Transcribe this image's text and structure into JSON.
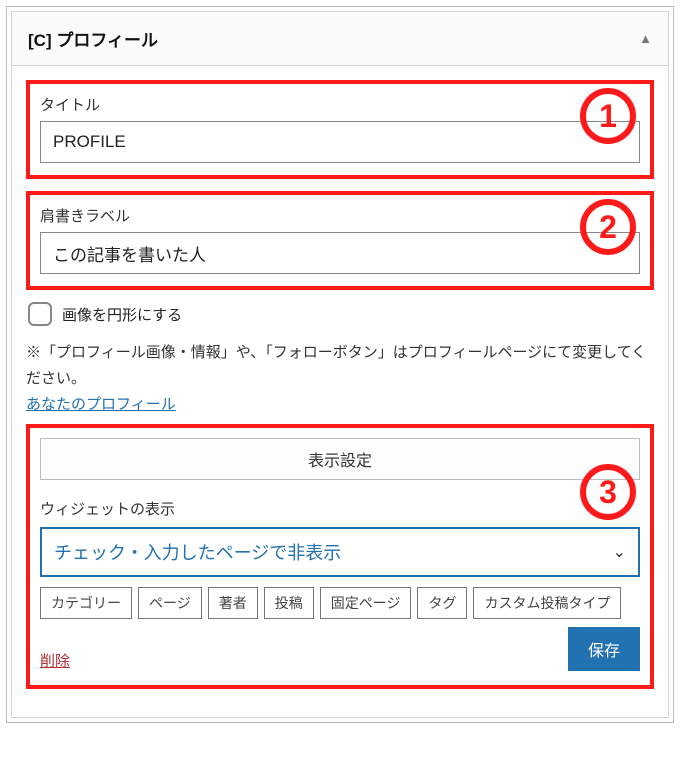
{
  "widget": {
    "title": "[C] プロフィール"
  },
  "section1": {
    "label": "タイトル",
    "value": "PROFILE",
    "badge": "1"
  },
  "section2": {
    "label": "肩書きラベル",
    "value": "この記事を書いた人",
    "badge": "2"
  },
  "checkbox": {
    "label": "画像を円形にする"
  },
  "note": {
    "text": "※「プロフィール画像・情報」や、「フォローボタン」はプロフィールページにて変更してください。",
    "link": "あなたのプロフィール"
  },
  "section3": {
    "details_button": "表示設定",
    "badge": "3",
    "sub_label": "ウィジェットの表示",
    "select_value": "チェック・入力したページで非表示",
    "tabs": [
      "カテゴリー",
      "ページ",
      "著者",
      "投稿",
      "固定ページ",
      "タグ",
      "カスタム投稿タイプ"
    ],
    "delete": "削除",
    "save": "保存"
  }
}
